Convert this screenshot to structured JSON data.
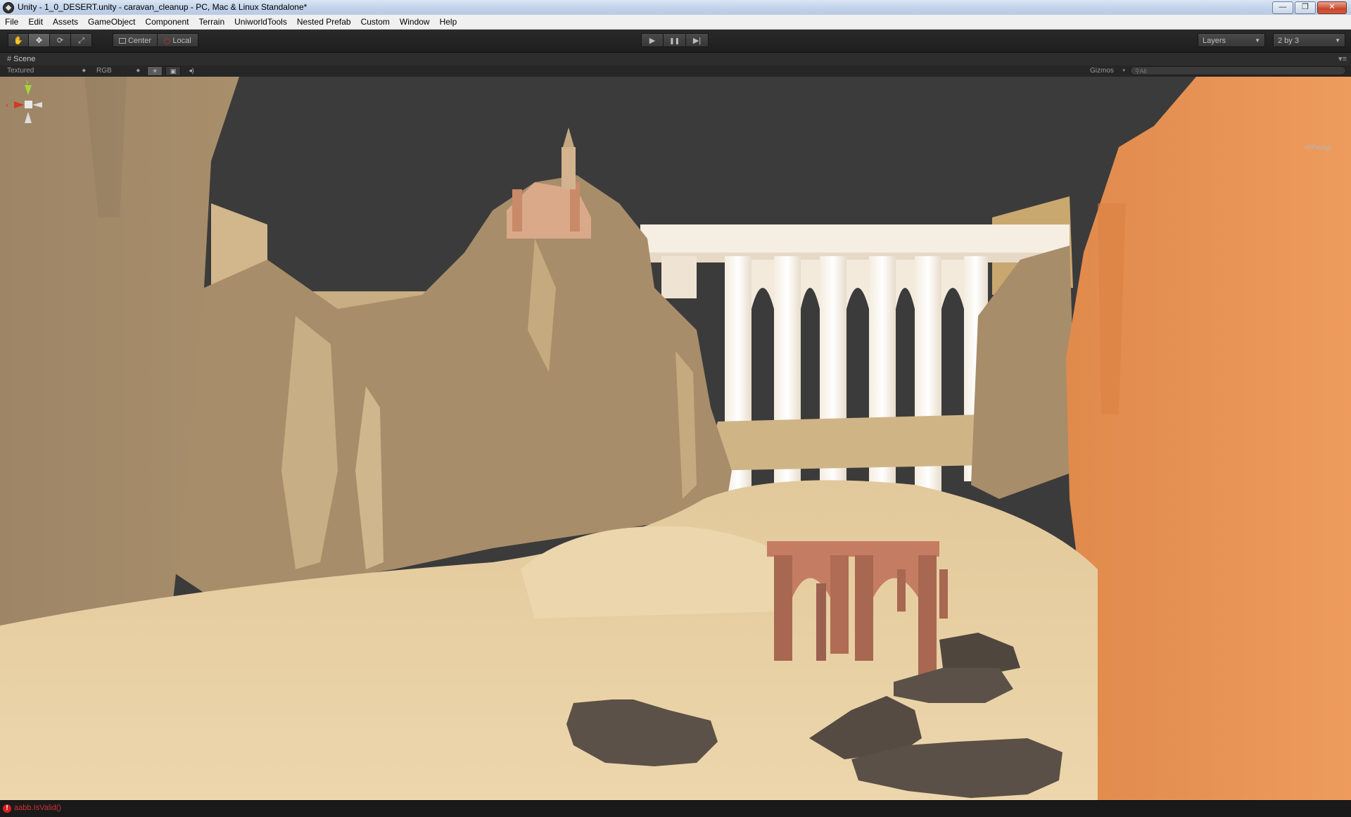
{
  "window": {
    "title": "Unity - 1_0_DESERT.unity - caravan_cleanup - PC, Mac & Linux Standalone*",
    "minimize": "—",
    "maximize": "❐",
    "close": "✕"
  },
  "menu": [
    "File",
    "Edit",
    "Assets",
    "GameObject",
    "Component",
    "Terrain",
    "UniworldTools",
    "Nested Prefab",
    "Custom",
    "Window",
    "Help"
  ],
  "toolbar": {
    "tools": [
      {
        "name": "hand-tool",
        "icon": "hand-icon",
        "glyph": "✋"
      },
      {
        "name": "move-tool",
        "icon": "move-icon",
        "glyph": "✥",
        "active": true
      },
      {
        "name": "rotate-tool",
        "icon": "rotate-icon",
        "glyph": "⟳"
      },
      {
        "name": "scale-tool",
        "icon": "scale-icon",
        "glyph": "⤢"
      }
    ],
    "pivot_mode": "Center",
    "pivot_rotation": "Local",
    "play": "▶",
    "pause": "❚❚",
    "step": "▶|",
    "layers": "Layers",
    "layout": "2 by 3"
  },
  "scene": {
    "tab_label": "Scene",
    "render_mode": "Textured",
    "color_mode": "RGB",
    "gizmos": "Gizmos",
    "search_placeholder": "All",
    "persp": "Persp",
    "axis_y": "y",
    "axis_x": "x"
  },
  "status": {
    "message": "aabb.IsValid()"
  }
}
